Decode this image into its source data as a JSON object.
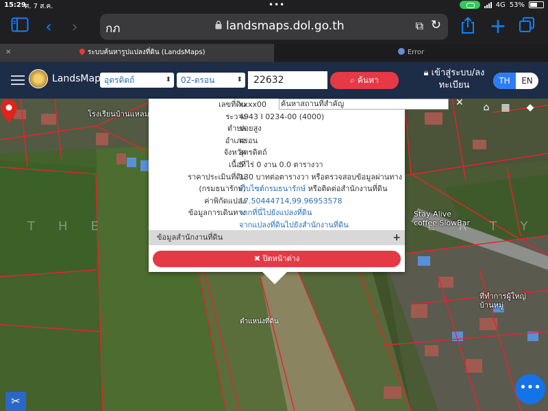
{
  "status_bar": {
    "time": "15:29",
    "date": "ศ. 7 ส.ค.",
    "network": "4G",
    "battery": "53%"
  },
  "browser": {
    "typed_text": "กภ",
    "url": "landsmaps.dol.go.th",
    "tabs": [
      {
        "title": "ระบบค้นหารูปแปลงที่ดิน (LandsMaps)",
        "active": true
      },
      {
        "title": "Error",
        "active": false
      }
    ]
  },
  "app": {
    "brand": "LandsMaps",
    "province_select": "อุตรดิตถ์",
    "district_select": "02-ตรอน",
    "parcel_number": "22632",
    "search_button": "ค้นหา",
    "login_line1": "เข้าสู่ระบบ/ลง",
    "login_line2": "ทะเบียน",
    "lang_th": "TH",
    "lang_en": "EN"
  },
  "map": {
    "watermark": "THE BEST PROPERTY",
    "poi_search_placeholder": "ค้นหาสถานที่สำคัญ",
    "pin_label": "ตำแหน่งที่ดิน",
    "labels": [
      {
        "text": "โรงเรียนบ้านแหลม"
      },
      {
        "text": "Stay Alive coffee SlowBar"
      },
      {
        "text": "ที่ทำการผู้ใหญ่บ้านหมู่"
      }
    ]
  },
  "popup": {
    "rows": [
      {
        "label": "เลขที่ดิน",
        "value": "xxxx00"
      },
      {
        "label": "ระวาง",
        "value": "4943 I 0234-00 (4000)"
      },
      {
        "label": "ตำบล",
        "value": "ข่อยสูง"
      },
      {
        "label": "อำเภอ",
        "value": "ตรอน"
      },
      {
        "label": "จังหวัด",
        "value": "อุตรดิตถ์"
      },
      {
        "label": "เนื้อที่",
        "value": "5 ไร่ 0 งาน 0.0 ตารางวา"
      },
      {
        "label": "ราคาประเมินที่ดิน",
        "value": "130 บาทต่อตารางวา หรือตรวจสอบข้อมูลผ่านทาง"
      },
      {
        "label": "(กรมธนารักษ์)",
        "value_link": "เว็บไซต์กรมธนารักษ์",
        "value_rest": " หรือติดต่อสำนักงานที่ดิน"
      },
      {
        "label": "ค่าพิกัดแปลง",
        "value": "17.50444714,99.96953578"
      },
      {
        "label": "ข้อมูลการเดินทาง",
        "value": "จากที่นี่ไปยังแปลงที่ดิน"
      },
      {
        "label": "",
        "value": "จากแปลงที่ดินไปยังสำนักงานที่ดิน"
      }
    ],
    "office_info": "ข้อมูลสำนักงานที่ดิน",
    "close_window": "ปิดหน้าต่าง"
  },
  "colors": {
    "header_bg": "#1d2c47",
    "accent_red": "#e53945",
    "accent_blue": "#2e7cf6",
    "link": "#2a6fb5"
  }
}
